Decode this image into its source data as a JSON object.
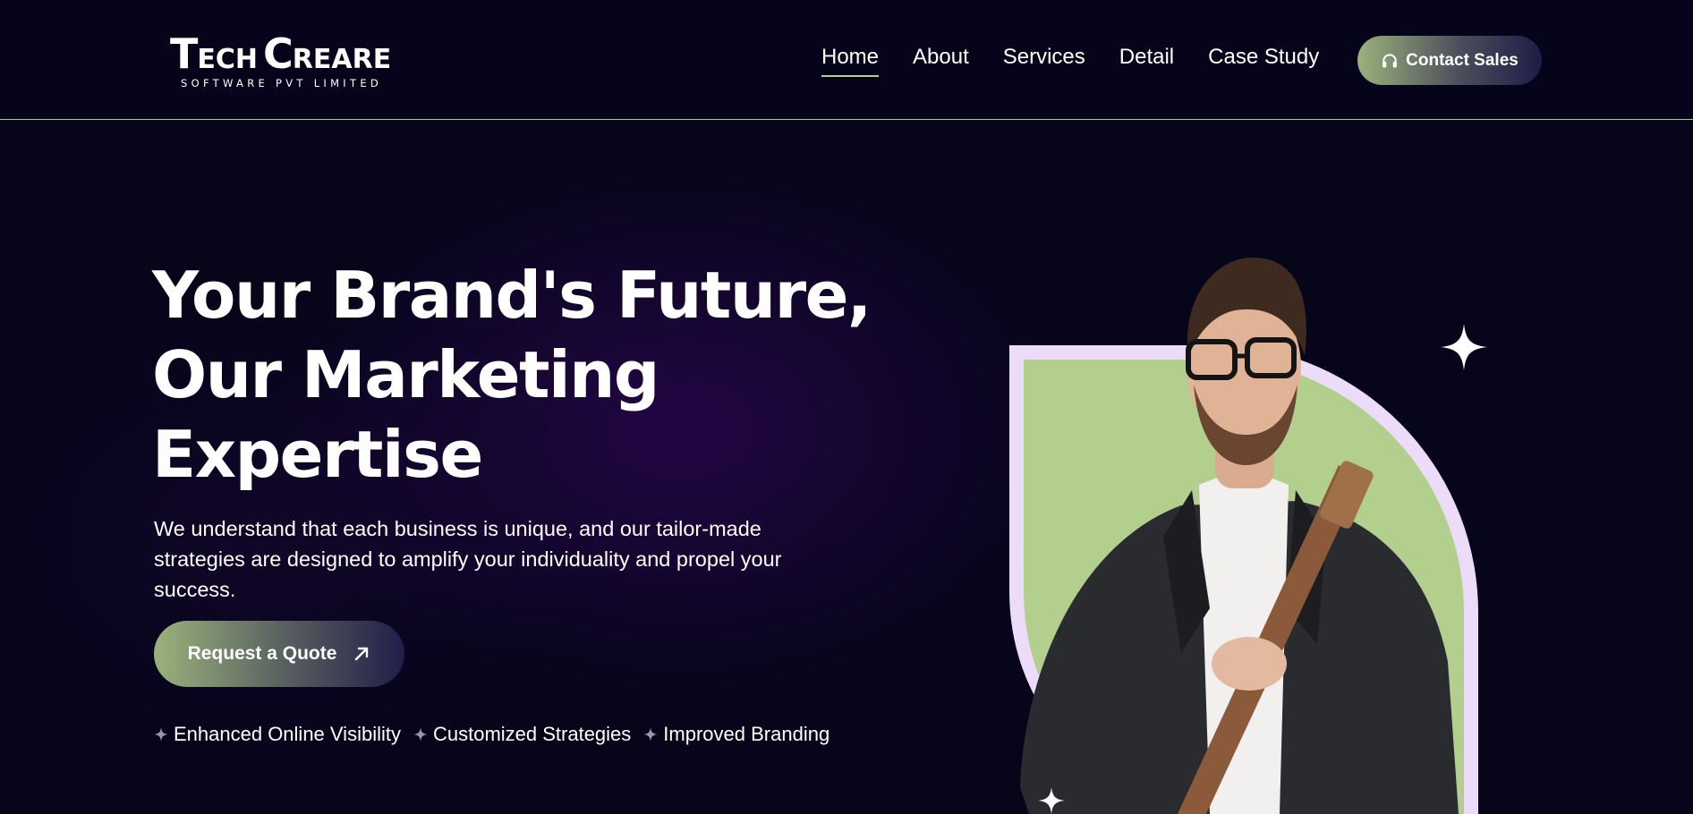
{
  "brand": {
    "name_first_letter": "T",
    "name_rest": "ECH",
    "name_second_letter": "C",
    "name_second_rest": "REARE",
    "tagline": "SOFTWARE PVT LIMITED"
  },
  "nav": {
    "items": [
      {
        "label": "Home",
        "active": true
      },
      {
        "label": "About"
      },
      {
        "label": "Services"
      },
      {
        "label": "Detail"
      },
      {
        "label": "Case Study"
      }
    ],
    "contact_label": "Contact Sales"
  },
  "hero": {
    "title_lines": [
      "Your Brand's Future,",
      "Our Marketing",
      "Expertise"
    ],
    "description": "We understand that each business is unique, and our tailor-made strategies are designed to amplify your individuality and propel your success.",
    "cta_label": "Request a Quote",
    "features": [
      "Enhanced Online Visibility",
      "Customized Strategies",
      "Improved Branding"
    ]
  },
  "icons": {
    "contact": "headset-icon",
    "cta": "arrow-up-right-icon",
    "feature": "sparkle-icon"
  },
  "colors": {
    "background": "#06051a",
    "accent_green": "#b2cf8e",
    "frame_lavender": "#ecdcfa",
    "button_dark": "#1f1c45"
  }
}
